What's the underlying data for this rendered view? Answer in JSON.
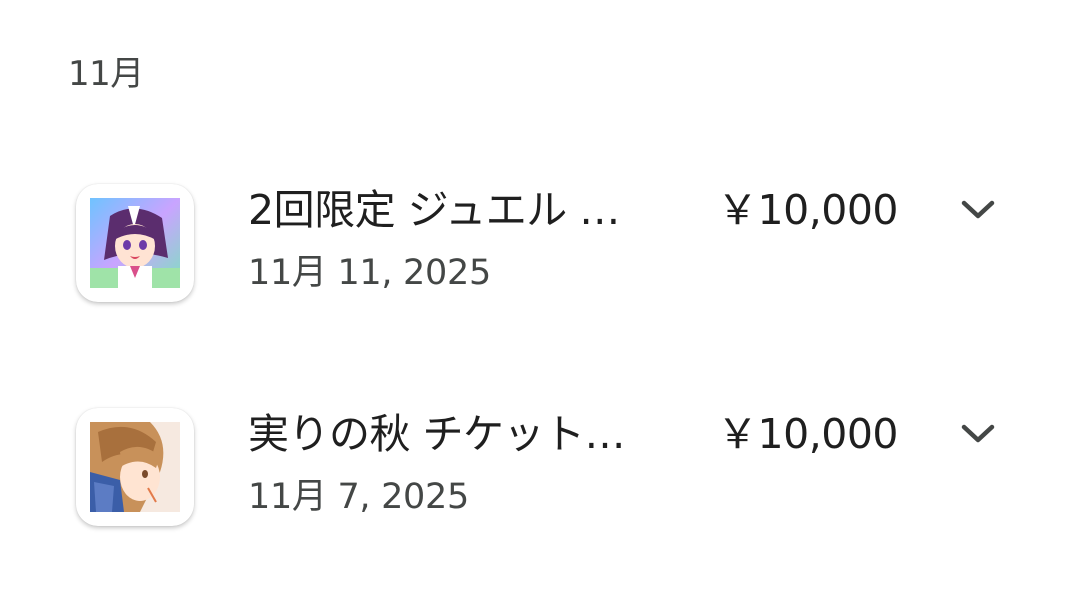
{
  "section": {
    "month_label": "11月"
  },
  "purchases": [
    {
      "title": "2回限定 ジュエル …",
      "date": "11月 11, 2025",
      "price": "￥10,000",
      "icon": "app-icon-anime-girl-purple-hair"
    },
    {
      "title": "実りの秋 チケット…",
      "date": "11月 7, 2025",
      "price": "￥10,000",
      "icon": "app-icon-anime-girl-blonde-hair"
    }
  ],
  "colors": {
    "primary_text": "#1f1f1f",
    "secondary_text": "#444746",
    "background": "#ffffff"
  }
}
